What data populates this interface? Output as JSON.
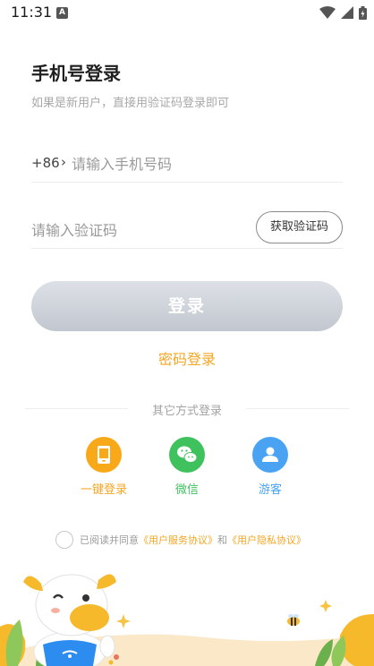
{
  "status_bar": {
    "time": "11:31",
    "notification_icon": "A"
  },
  "header": {
    "title": "手机号登录",
    "subtitle": "如果是新用户，直接用验证码登录即可"
  },
  "phone_field": {
    "country_code": "+86",
    "chevron": "›",
    "placeholder": "请输入手机号码",
    "value": ""
  },
  "code_field": {
    "placeholder": "请输入验证码",
    "value": "",
    "get_code_label": "获取验证码"
  },
  "login_button_label": "登录",
  "password_login_label": "密码登录",
  "other_methods": {
    "title": "其它方式登录",
    "items": [
      {
        "label": "一键登录",
        "icon": "phone-icon",
        "color": "#f8a91a"
      },
      {
        "label": "微信",
        "icon": "wechat-icon",
        "color": "#3fc25d"
      },
      {
        "label": "游客",
        "icon": "user-icon",
        "color": "#4aa3f2"
      }
    ]
  },
  "agreement": {
    "prefix": "已阅读并同意",
    "service_link": "《用户服务协议》",
    "conjunction": "和",
    "privacy_link": "《用户隐私协议》"
  },
  "colors": {
    "accent": "#f5a623",
    "button_disabled_top": "#dde1e7",
    "button_disabled_bottom": "#c2c7cf"
  }
}
